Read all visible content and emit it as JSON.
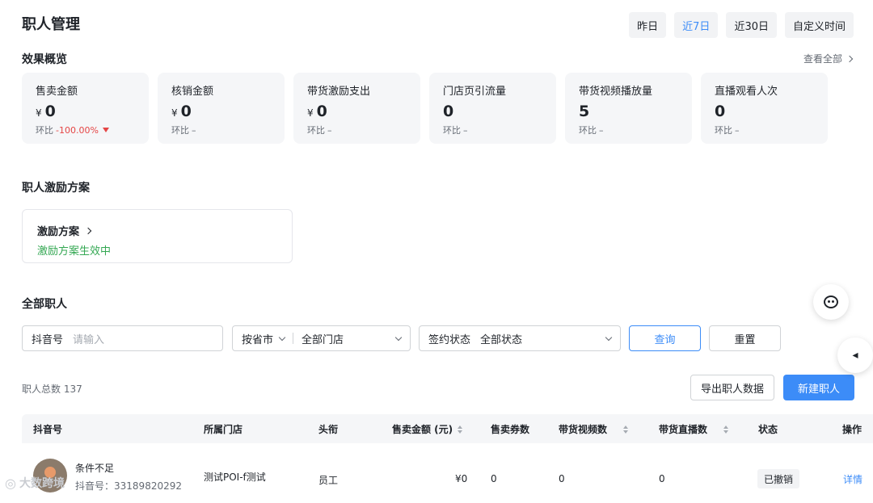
{
  "page": {
    "title": "职人管理"
  },
  "date_range": {
    "options": [
      "昨日",
      "近7日",
      "近30日",
      "自定义时间"
    ],
    "selected": "近7日"
  },
  "overview": {
    "title": "效果概览",
    "view_all": "查看全部",
    "cmp_prefix": "环比",
    "metrics": [
      {
        "label": "售卖金额",
        "currency": "¥",
        "value": "0",
        "cmp": "-100.00%",
        "cmp_down": true
      },
      {
        "label": "核销金额",
        "currency": "¥",
        "value": "0",
        "cmp": "–"
      },
      {
        "label": "带货激励支出",
        "currency": "¥",
        "value": "0",
        "cmp": "–"
      },
      {
        "label": "门店页引流量",
        "value": "0",
        "cmp": "–"
      },
      {
        "label": "带货视频播放量",
        "value": "5",
        "cmp": "–"
      },
      {
        "label": "直播观看人次",
        "value": "0",
        "cmp": "–"
      }
    ]
  },
  "incentive": {
    "section_title": "职人激励方案",
    "card_title": "激励方案",
    "status": "激励方案生效中"
  },
  "staff": {
    "section_title": "全部职人",
    "filters": {
      "douyin_label": "抖音号",
      "douyin_placeholder": "请输入",
      "province_label": "按省市",
      "store_value": "全部门店",
      "sign_label": "签约状态",
      "sign_value": "全部状态"
    },
    "query_btn": "查询",
    "reset_btn": "重置",
    "total": "职人总数 137",
    "export_btn": "导出职人数据",
    "new_btn": "新建职人",
    "columns": [
      "抖音号",
      "所属门店",
      "头衔",
      "售卖金额 (元)",
      "售卖券数",
      "带货视频数",
      "带货直播数",
      "状态",
      "操作"
    ],
    "rows": [
      {
        "name": "条件不足",
        "douyin_prefix": "抖音号：",
        "douyin_id": "33189820292",
        "store": "测试POI-f测试",
        "title": "员工",
        "amount": "¥0",
        "coupons": "0",
        "videos": "0",
        "lives": "0",
        "status": "已撤销",
        "action": "详情"
      }
    ]
  },
  "brand": {
    "text": "大数跨境"
  }
}
